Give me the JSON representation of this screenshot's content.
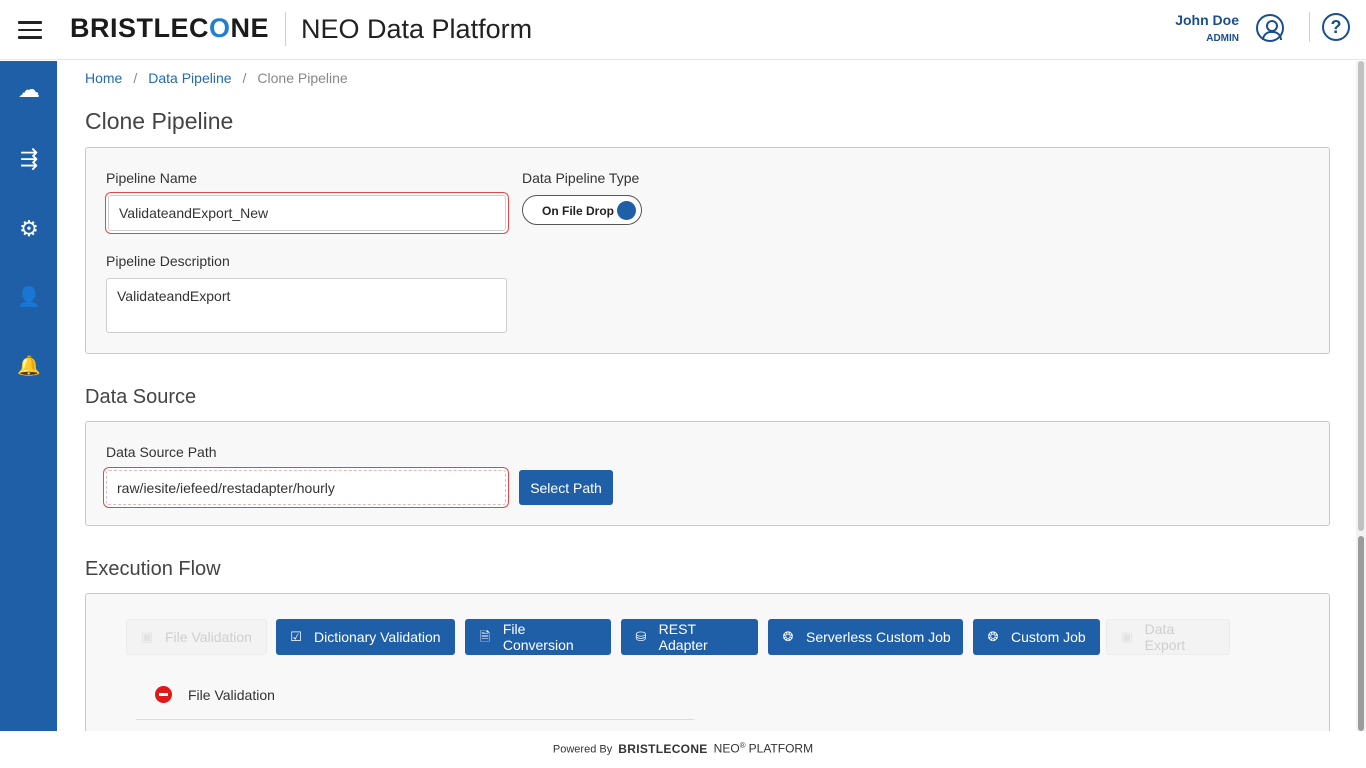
{
  "header": {
    "logo_text_pre": "BRISTLEC",
    "logo_text_o": "O",
    "logo_text_post": "NE",
    "platform_name": "NEO Data Platform",
    "user_name": "John Doe",
    "user_role": "ADMIN",
    "help_glyph": "?"
  },
  "sidebar": {
    "items": [
      {
        "name": "cloud-network-icon",
        "glyph": "☁"
      },
      {
        "name": "pipeline-flow-icon",
        "glyph": "⇶"
      },
      {
        "name": "settings-tools-icon",
        "glyph": "⚙"
      },
      {
        "name": "user-admin-icon",
        "glyph": "👤"
      },
      {
        "name": "notification-bell-icon",
        "glyph": "🔔"
      }
    ]
  },
  "breadcrumb": {
    "home": "Home",
    "data_pipeline": "Data Pipeline",
    "current": "Clone Pipeline",
    "separator": "/"
  },
  "page_title": "Clone Pipeline",
  "pipeline_form": {
    "name_label": "Pipeline Name",
    "name_value": "ValidateandExport_New",
    "type_label": "Data Pipeline Type",
    "type_toggle_label": "On File Drop",
    "description_label": "Pipeline Description",
    "description_value": "ValidateandExport"
  },
  "data_source": {
    "section_title": "Data Source",
    "path_label": "Data Source Path",
    "path_value": "raw/iesite/iefeed/restadapter/hourly",
    "select_path_label": "Select Path"
  },
  "execution_flow": {
    "section_title": "Execution Flow",
    "steps": [
      {
        "label": "File Validation",
        "enabled": false,
        "icon": "file-validation-icon"
      },
      {
        "label": "Dictionary Validation",
        "enabled": true,
        "icon": "dictionary-icon"
      },
      {
        "label": "File Conversion",
        "enabled": true,
        "icon": "file-conversion-icon"
      },
      {
        "label": "REST Adapter",
        "enabled": true,
        "icon": "rest-adapter-icon"
      },
      {
        "label": "Serverless Custom Job",
        "enabled": true,
        "icon": "serverless-icon"
      },
      {
        "label": "Custom Job",
        "enabled": true,
        "icon": "custom-job-icon"
      },
      {
        "label": "Data Export",
        "enabled": false,
        "icon": "data-export-icon"
      }
    ],
    "flow_items": [
      {
        "label": "File Validation"
      }
    ]
  },
  "footer": {
    "powered_by": "Powered By",
    "brand": "BRISTLECONE",
    "neo": "NEO",
    "registered": "®",
    "platform": "PLATFORM"
  }
}
